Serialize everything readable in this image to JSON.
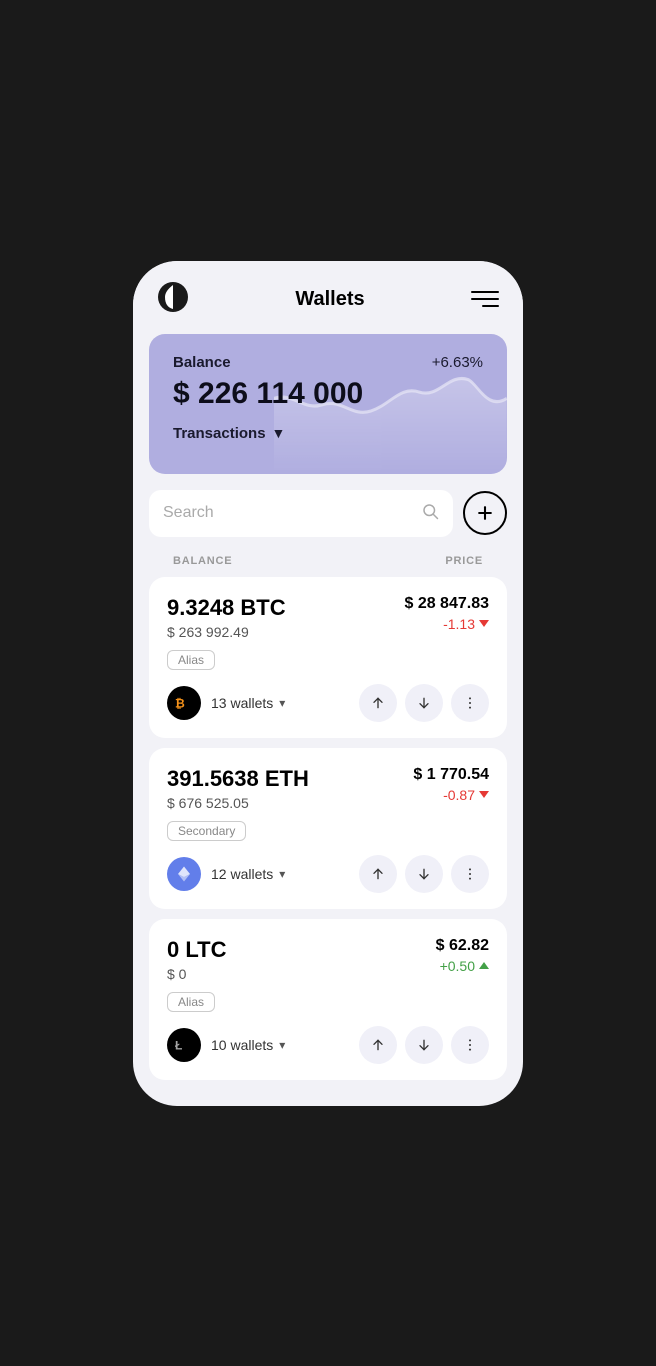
{
  "header": {
    "title": "Wallets",
    "menu_label": "menu"
  },
  "balance_card": {
    "label": "Balance",
    "amount": "$ 226 114 000",
    "percent": "+6.63%",
    "transactions_label": "Transactions"
  },
  "search": {
    "placeholder": "Search"
  },
  "table": {
    "col_balance": "BALANCE",
    "col_price": "PRICE"
  },
  "coins": [
    {
      "id": "btc",
      "amount": "9.3248 BTC",
      "usd": "$ 263 992.49",
      "price": "$ 28 847.83",
      "change": "-1.13",
      "change_type": "negative",
      "alias": "Alias",
      "wallets": "13 wallets",
      "symbol": "₿",
      "logo_type": "btc"
    },
    {
      "id": "eth",
      "amount": "391.5638 ETH",
      "usd": "$ 676 525.05",
      "price": "$ 1 770.54",
      "change": "-0.87",
      "change_type": "negative",
      "alias": "Secondary",
      "wallets": "12 wallets",
      "symbol": "⬡",
      "logo_type": "eth"
    },
    {
      "id": "ltc",
      "amount": "0 LTC",
      "usd": "$ 0",
      "price": "$ 62.82",
      "change": "+0.50",
      "change_type": "positive",
      "alias": "Alias",
      "wallets": "10 wallets",
      "symbol": "Ł",
      "logo_type": "ltc"
    }
  ]
}
